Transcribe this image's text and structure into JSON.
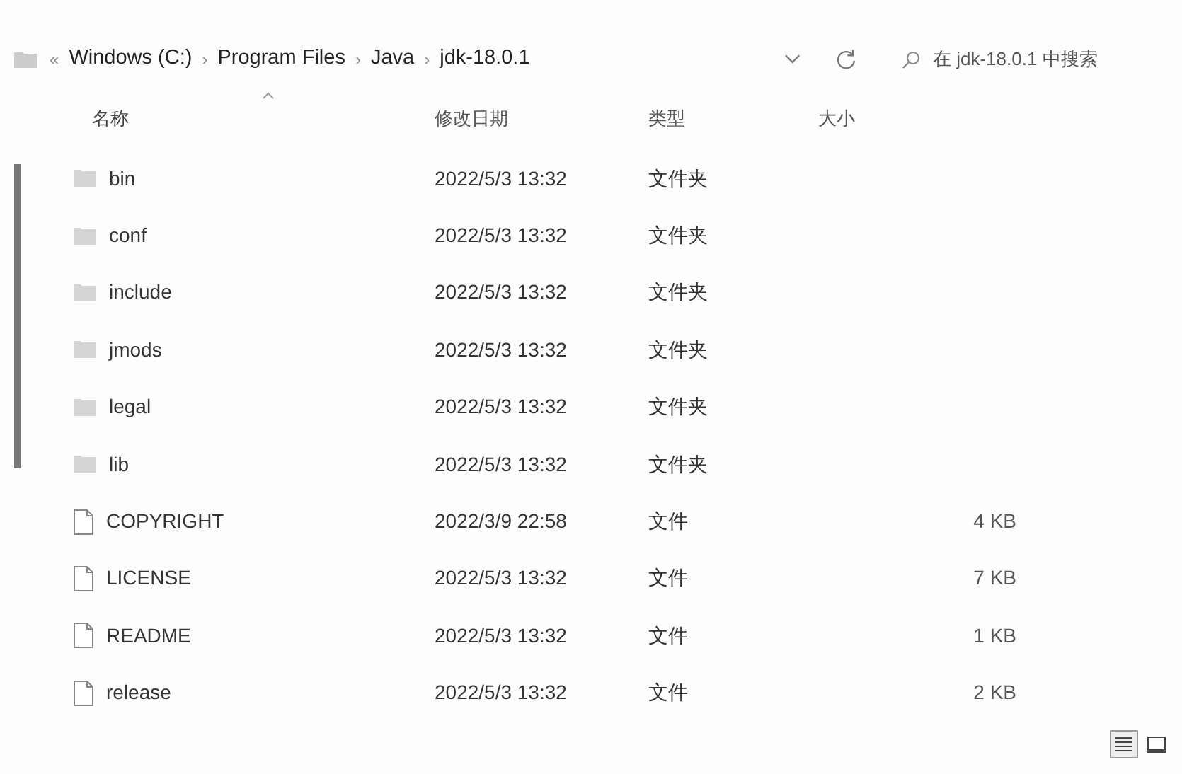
{
  "address_bar": {
    "overflow": "«",
    "path": [
      {
        "label": "Windows (C:)"
      },
      {
        "label": "Program Files"
      },
      {
        "label": "Java"
      },
      {
        "label": "jdk-18.0.1"
      }
    ],
    "separator": "›"
  },
  "search": {
    "placeholder": "在 jdk-18.0.1 中搜索"
  },
  "columns": [
    {
      "label": "名称",
      "sorted": true
    },
    {
      "label": "修改日期",
      "sorted": false
    },
    {
      "label": "类型",
      "sorted": false
    },
    {
      "label": "大小",
      "sorted": false
    }
  ],
  "rows": [
    {
      "kind": "folder",
      "name": "bin",
      "modified": "2022/5/3 13:32",
      "type": "文件夹"
    },
    {
      "kind": "folder",
      "name": "conf",
      "modified": "2022/5/3 13:32",
      "type": "文件夹"
    },
    {
      "kind": "folder",
      "name": "include",
      "modified": "2022/5/3 13:32",
      "type": "文件夹"
    },
    {
      "kind": "folder",
      "name": "jmods",
      "modified": "2022/5/3 13:32",
      "type": "文件夹"
    },
    {
      "kind": "folder",
      "name": "legal",
      "modified": "2022/5/3 13:32",
      "type": "文件夹"
    },
    {
      "kind": "folder",
      "name": "lib",
      "modified": "2022/5/3 13:32",
      "type": "文件夹"
    },
    {
      "kind": "file",
      "name": "COPYRIGHT",
      "modified": "2022/3/9 22:58",
      "type": "文件",
      "size": "4 KB"
    },
    {
      "kind": "file",
      "name": "LICENSE",
      "modified": "2022/5/3 13:32",
      "type": "文件",
      "size": "7 KB"
    },
    {
      "kind": "file",
      "name": "README",
      "modified": "2022/5/3 13:32",
      "type": "文件",
      "size": "1 KB"
    },
    {
      "kind": "file",
      "name": "release",
      "modified": "2022/5/3 13:32",
      "type": "文件",
      "size": "2 KB"
    }
  ],
  "view_buttons": [
    {
      "kind": "details",
      "selected": true
    },
    {
      "kind": "tiles",
      "selected": false
    }
  ]
}
